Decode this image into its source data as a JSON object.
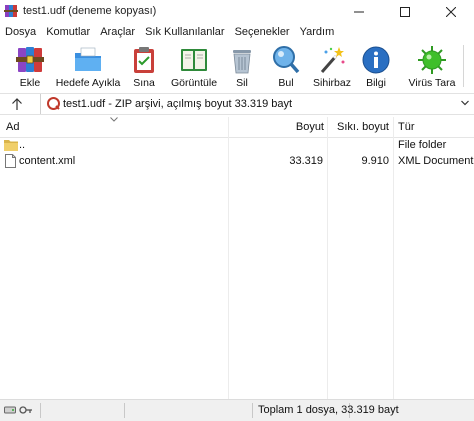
{
  "window": {
    "title": "test1.udf (deneme kopyası)",
    "controls": [
      "minimize-icon",
      "maximize-icon",
      "close-icon"
    ]
  },
  "menu": [
    "Dosya",
    "Komutlar",
    "Araçlar",
    "Sık Kullanılanlar",
    "Seçenekler",
    "Yardım"
  ],
  "toolbar": {
    "buttons": [
      {
        "label": "Ekle",
        "icon": "archive-books-icon"
      },
      {
        "label": "Hedefe Ayıkla",
        "icon": "folder-extract-icon"
      },
      {
        "label": "Sına",
        "icon": "clipboard-check-icon"
      },
      {
        "label": "Görüntüle",
        "icon": "open-book-icon"
      },
      {
        "label": "Sil",
        "icon": "trash-can-icon"
      },
      {
        "label": "Bul",
        "icon": "magnifier-icon"
      },
      {
        "label": "Sihirbaz",
        "icon": "magic-wand-icon"
      },
      {
        "label": "Bilgi",
        "icon": "info-icon"
      },
      {
        "label": "Virüs Tara",
        "icon": "virus-scan-icon"
      }
    ]
  },
  "address": {
    "text": "test1.udf - ZIP arşivi, açılmış boyut 33.319 bayt"
  },
  "columns": {
    "name": "Ad",
    "size": "Boyut",
    "packed": "Sıkı. boyut",
    "type": "Tür"
  },
  "files": [
    {
      "name": "..",
      "size": "",
      "packed": "",
      "type": "File folder",
      "icon": "folder-icon"
    },
    {
      "name": "content.xml",
      "size": "33.319",
      "packed": "9.910",
      "type": "XML Document",
      "icon": "document-icon"
    }
  ],
  "status": {
    "summary": "Toplam 1 dosya, 33.319 bayt"
  },
  "colors": {
    "accent": "#0078d7",
    "folder": "#e8c65a",
    "virus_green": "#3fbf2a"
  }
}
